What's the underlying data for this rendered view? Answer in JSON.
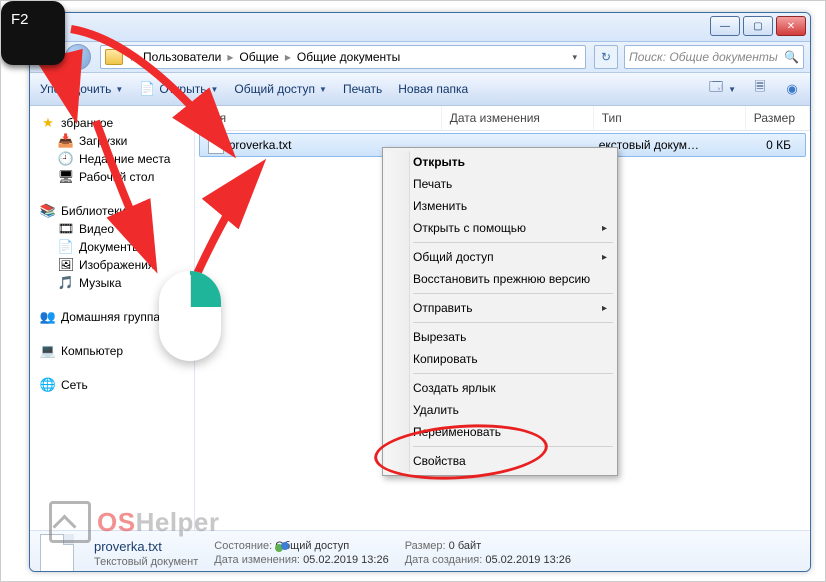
{
  "key_annotation": "F2",
  "breadcrumb": {
    "seg1": "Пользователи",
    "seg2": "Общие",
    "seg3": "Общие документы"
  },
  "search": {
    "placeholder": "Поиск: Общие документы"
  },
  "toolbar": {
    "organize": "Упорядочить",
    "open": "Открыть",
    "share": "Общий доступ",
    "print": "Печать",
    "new_folder": "Новая папка"
  },
  "columns": {
    "name": "Имя",
    "date": "Дата изменения",
    "type": "Тип",
    "size": "Размер"
  },
  "file": {
    "name": "proverka.txt",
    "date": "",
    "type": "екстовый докум…",
    "size": "0 КБ"
  },
  "sidebar": {
    "favorites": "збранное",
    "downloads": "Загрузки",
    "recent": "Недавние места",
    "desktop": "Рабочий стол",
    "libraries": "Библиотеки",
    "video": "Видео",
    "documents": "Документы",
    "pictures": "Изображения",
    "music": "Музыка",
    "homegroup": "Домашняя группа",
    "computer": "Компьютер",
    "network": "Сеть"
  },
  "context_menu": {
    "open": "Открыть",
    "print": "Печать",
    "edit": "Изменить",
    "open_with": "Открыть с помощью",
    "share": "Общий доступ",
    "restore": "Восстановить прежнюю версию",
    "send_to": "Отправить",
    "cut": "Вырезать",
    "copy": "Копировать",
    "shortcut": "Создать ярлык",
    "delete": "Удалить",
    "rename": "Переименовать",
    "properties": "Свойства"
  },
  "status": {
    "filename": "proverka.txt",
    "filetype": "Текстовый документ",
    "state_label": "Состояние:",
    "state_icon": "users",
    "mod_label": "Дата изменения:",
    "mod_value": "05.02.2019 13:26",
    "size_label": "Размер:",
    "size_value": "0 байт",
    "created_label": "Дата создания:",
    "created_value": "05.02.2019 13:26",
    "shared": "Общий доступ"
  },
  "watermark": {
    "os": "OS",
    "helper": "Helper"
  }
}
